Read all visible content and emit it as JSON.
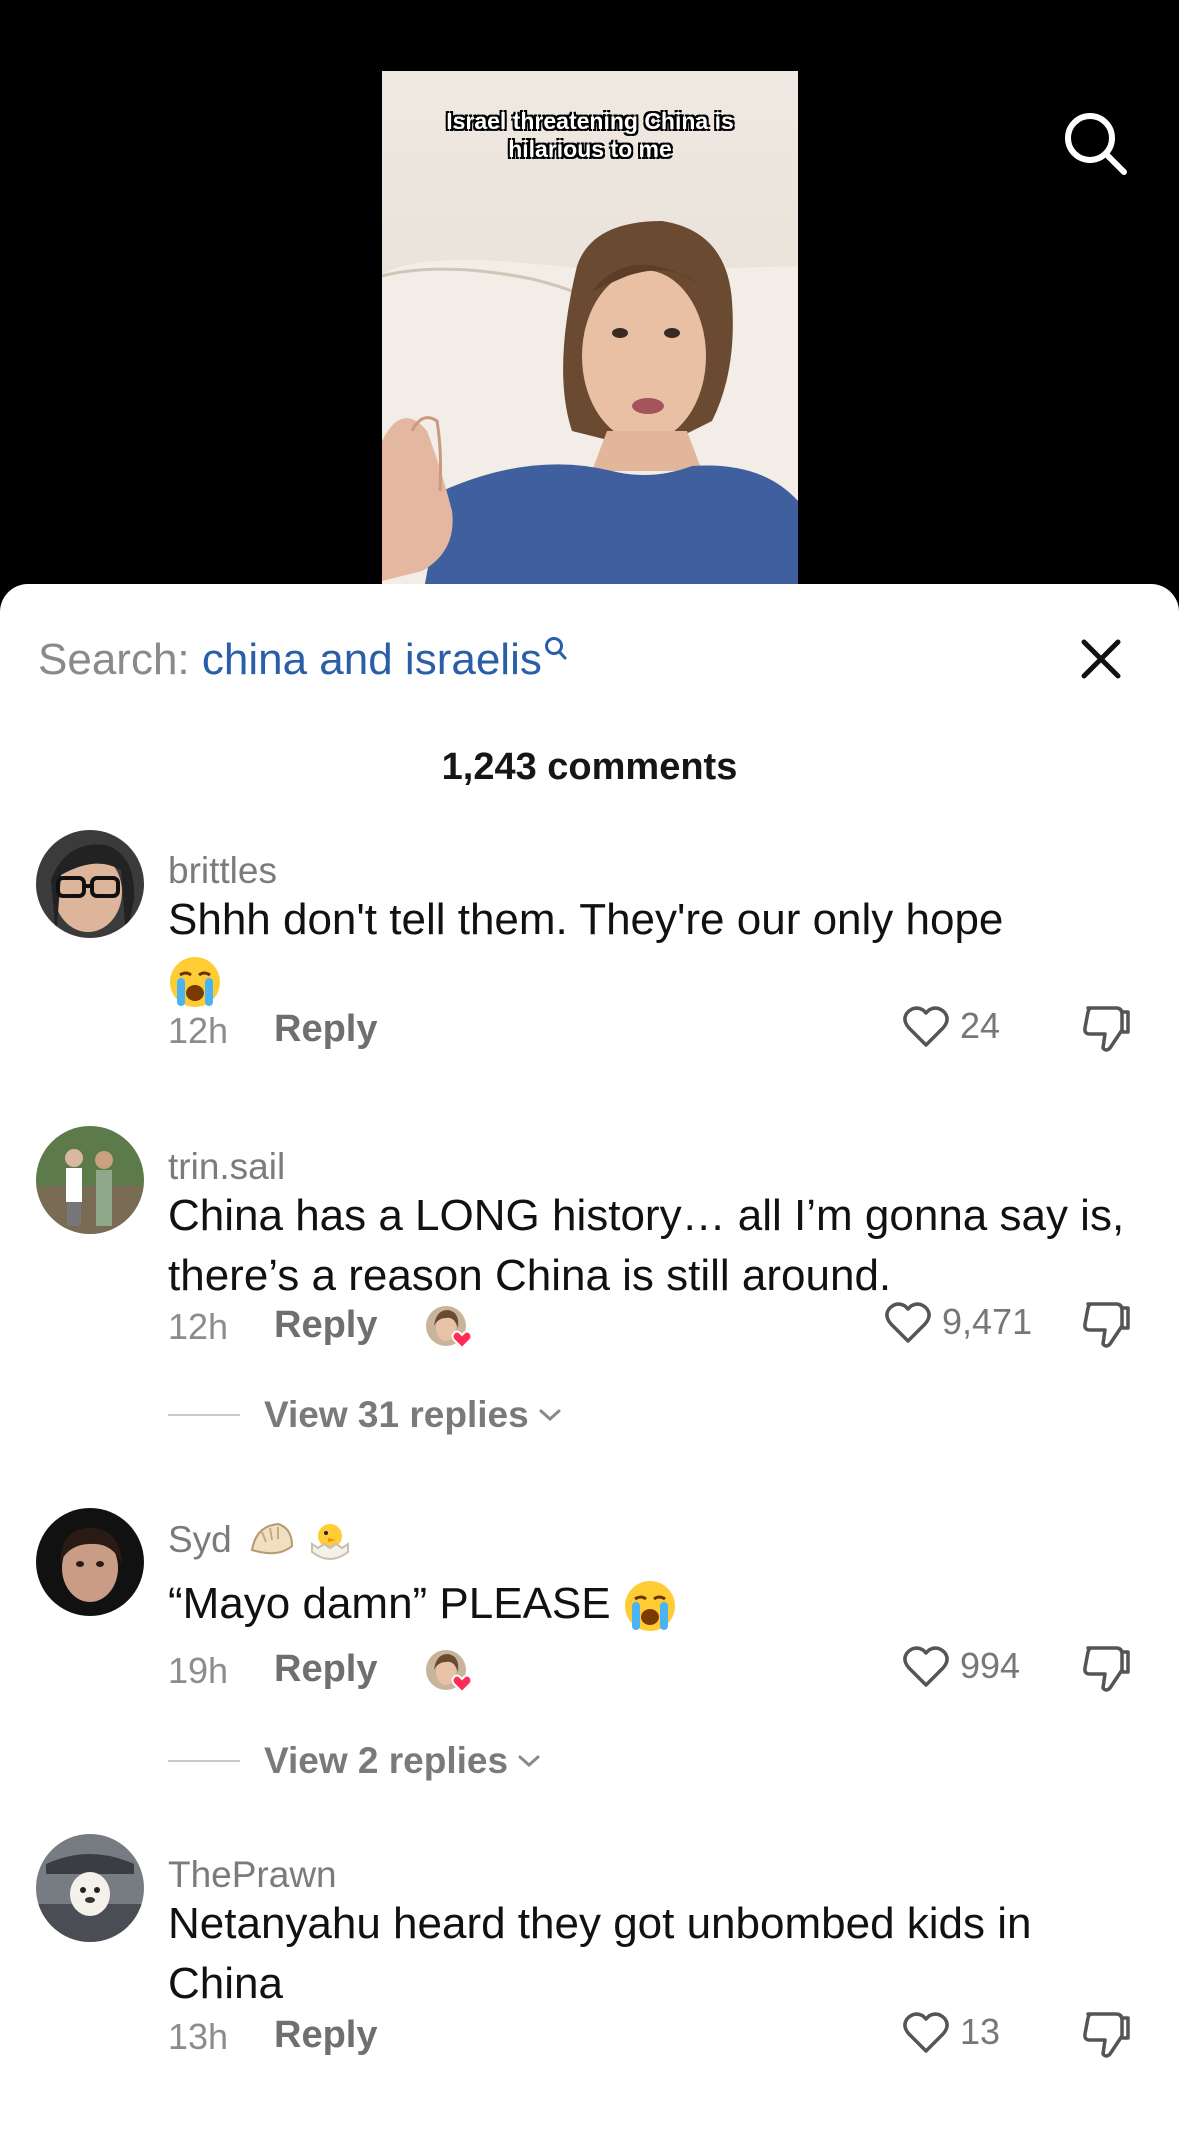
{
  "video": {
    "caption": "Israel threatening China is hilarious to me"
  },
  "comments_panel": {
    "search_prefix": "Search:",
    "search_term": "china and israelis",
    "comment_count": "1,243 comments",
    "comments": [
      {
        "username": "brittles",
        "text": "Shhh don't tell them. They're our only hope",
        "time": "12h",
        "reply_label": "Reply",
        "likes": "24"
      },
      {
        "username": "trin.sail",
        "text": "China has a LONG history… all I’m gonna say is, there’s a reason China is still around.",
        "time": "12h",
        "reply_label": "Reply",
        "likes": "9,471",
        "view_replies": "View 31 replies"
      },
      {
        "username": "Syd",
        "text": "“Mayo damn” PLEASE",
        "time": "19h",
        "reply_label": "Reply",
        "likes": "994",
        "view_replies": "View 2 replies"
      },
      {
        "username": "ThePrawn",
        "text": "Netanyahu heard they got unbombed kids in China",
        "time": "13h",
        "reply_label": "Reply",
        "likes": "13"
      }
    ]
  },
  "icons": {
    "search": "search-icon",
    "close": "close-icon",
    "heart": "heart-icon",
    "dislike": "thumbs-down-icon",
    "creator_liked": "creator-liked-badge"
  },
  "colors": {
    "search_term": "#2a5ea8",
    "heart_badge": "#fe2c55"
  }
}
